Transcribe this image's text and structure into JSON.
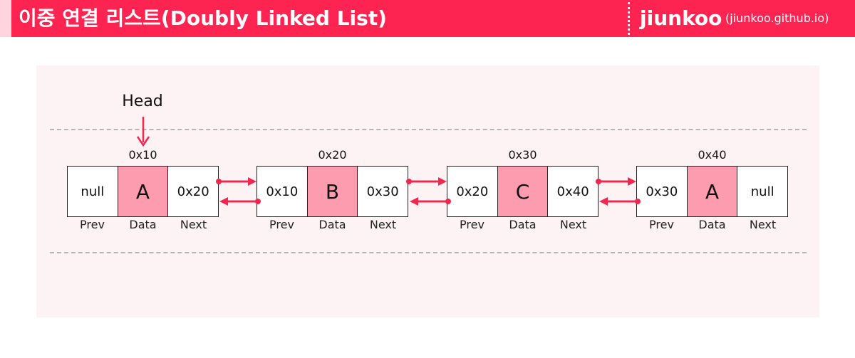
{
  "header": {
    "title": "이중 연결 리스트(Doubly Linked List)",
    "brand": "jiunkoo",
    "brand_url": "(jiunkoo.github.io)"
  },
  "diagram": {
    "head_label": "Head",
    "field_labels": {
      "prev": "Prev",
      "data": "Data",
      "next": "Next"
    },
    "nodes": [
      {
        "address": "0x10",
        "prev": "null",
        "data": "A",
        "next": "0x20"
      },
      {
        "address": "0x20",
        "prev": "0x10",
        "data": "B",
        "next": "0x30"
      },
      {
        "address": "0x30",
        "prev": "0x20",
        "data": "C",
        "next": "0x40"
      },
      {
        "address": "0x40",
        "prev": "0x30",
        "data": "A",
        "next": "null"
      }
    ]
  },
  "colors": {
    "accent": "#fe2451",
    "header_strip": "#ffd4de",
    "canvas_bg": "#fef3f4",
    "data_cell": "#fd9cae",
    "arrow": "#f0284f"
  }
}
